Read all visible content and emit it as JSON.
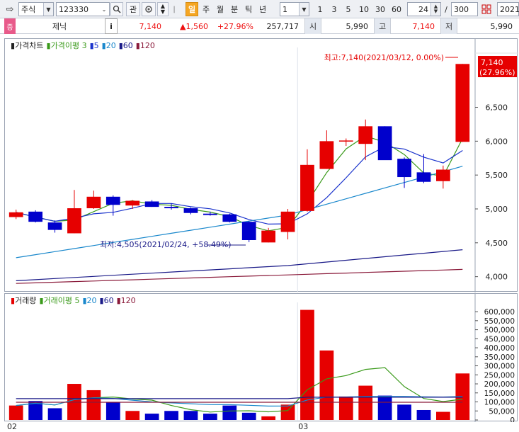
{
  "toolbar": {
    "market": "주식",
    "code": "123330",
    "watch_label": "관",
    "period_buttons": [
      "일",
      "주",
      "월",
      "분",
      "틱",
      "년"
    ],
    "interval_value": "1",
    "quick_buttons": [
      "1",
      "3",
      "5",
      "10",
      "30",
      "60"
    ],
    "count_value": "24",
    "slash": "/",
    "total_value": "300",
    "date_value": "2021/"
  },
  "quote": {
    "tag": "증",
    "name": "제닉",
    "info_button": "i",
    "price": "7,140",
    "change": "▲1,560",
    "change_pct": "+27.96%",
    "volume": "257,717",
    "open_label": "시",
    "open_value": "5,990",
    "high_label": "고",
    "high_value": "7,140",
    "low_label": "저",
    "low_value": "5,990"
  },
  "price_panel": {
    "legend": [
      {
        "text": "가격차트",
        "color": "#222222"
      },
      {
        "text": "가격이평 3",
        "color": "#3a9a1a"
      },
      {
        "text": "5",
        "color": "#1a33cc"
      },
      {
        "text": "20",
        "color": "#1a88cc"
      },
      {
        "text": "60",
        "color": "#1a1a88"
      },
      {
        "text": "120",
        "color": "#8a1a3a"
      }
    ],
    "high_note": "최고:7,140(2021/03/12, 0.00%)",
    "low_note": "최저:4,505(2021/02/24, +58.49%)",
    "last_price": "7,140",
    "last_pct": "(27.96%)",
    "y_ticks": [
      "6,500",
      "6,000",
      "5,500",
      "5,000",
      "4,500",
      "4,000"
    ]
  },
  "volume_panel": {
    "legend": [
      {
        "text": "거래량",
        "color": "#222222"
      },
      {
        "text": "거래이평 5",
        "color": "#3a9a1a"
      },
      {
        "text": "20",
        "color": "#1a88cc"
      },
      {
        "text": "60",
        "color": "#1a1a88"
      },
      {
        "text": "120",
        "color": "#8a1a3a"
      }
    ],
    "y_ticks": [
      "600,000",
      "550,000",
      "500,000",
      "450,000",
      "400,000",
      "350,000",
      "300,000",
      "250,000",
      "200,000",
      "150,000",
      "100,000",
      "50,000",
      "0"
    ],
    "x_labels": [
      "02",
      "03"
    ]
  },
  "colors": {
    "up": "#e60000",
    "down": "#0000cc",
    "ma3": "#3a9a1a",
    "ma5": "#1a33cc",
    "ma20": "#1a88cc",
    "ma60": "#1a1a88",
    "ma120": "#8a1a3a"
  },
  "chart_data": {
    "type": "candlestick",
    "series": [
      {
        "name": "가격차트",
        "candles": [
          {
            "o": 4880,
            "h": 4990,
            "l": 4850,
            "c": 4950
          },
          {
            "o": 4960,
            "h": 4980,
            "l": 4800,
            "c": 4810
          },
          {
            "o": 4800,
            "h": 4830,
            "l": 4650,
            "c": 4690
          },
          {
            "o": 4640,
            "h": 5280,
            "l": 4640,
            "c": 5010
          },
          {
            "o": 5010,
            "h": 5270,
            "l": 5000,
            "c": 5180
          },
          {
            "o": 5180,
            "h": 5200,
            "l": 4900,
            "c": 5060
          },
          {
            "o": 5050,
            "h": 5130,
            "l": 5000,
            "c": 5120
          },
          {
            "o": 5110,
            "h": 5130,
            "l": 5030,
            "c": 5030
          },
          {
            "o": 5030,
            "h": 5080,
            "l": 4990,
            "c": 5010
          },
          {
            "o": 5010,
            "h": 5020,
            "l": 4920,
            "c": 4940
          },
          {
            "o": 4930,
            "h": 4960,
            "l": 4900,
            "c": 4910
          },
          {
            "o": 4920,
            "h": 4930,
            "l": 4800,
            "c": 4810
          },
          {
            "o": 4810,
            "h": 4820,
            "l": 4510,
            "c": 4540
          },
          {
            "o": 4505,
            "h": 4720,
            "l": 4505,
            "c": 4680
          },
          {
            "o": 4660,
            "h": 5000,
            "l": 4550,
            "c": 4960
          },
          {
            "o": 4970,
            "h": 5880,
            "l": 4960,
            "c": 5650
          },
          {
            "o": 5590,
            "h": 6160,
            "l": 5590,
            "c": 6000
          },
          {
            "o": 6000,
            "h": 6040,
            "l": 5930,
            "c": 6010
          },
          {
            "o": 5960,
            "h": 6320,
            "l": 5720,
            "c": 6220
          },
          {
            "o": 6220,
            "h": 6220,
            "l": 5740,
            "c": 5720
          },
          {
            "o": 5740,
            "h": 5760,
            "l": 5310,
            "c": 5470
          },
          {
            "o": 5540,
            "h": 5810,
            "l": 5380,
            "c": 5400
          },
          {
            "o": 5410,
            "h": 5640,
            "l": 5300,
            "c": 5580
          },
          {
            "o": 5990,
            "h": 7140,
            "l": 5990,
            "c": 7140
          }
        ]
      },
      {
        "name": "거래량",
        "values": [
          80000,
          105000,
          65000,
          200000,
          165000,
          100000,
          50000,
          35000,
          50000,
          50000,
          35000,
          80000,
          40000,
          20000,
          85000,
          610000,
          385000,
          130000,
          190000,
          135000,
          85000,
          55000,
          45000,
          257717
        ]
      }
    ],
    "xlabel": "",
    "ylim_price": [
      3850,
      7300
    ],
    "ylim_volume": [
      0,
      620000
    ],
    "x_labels": [
      "02",
      "03"
    ]
  }
}
